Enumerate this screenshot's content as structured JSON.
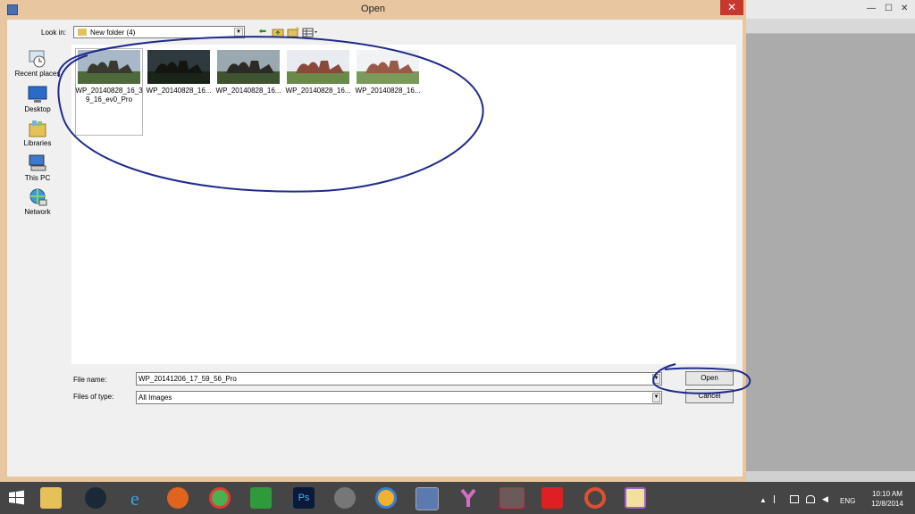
{
  "dialog": {
    "title": "Open",
    "close_glyph": "✕",
    "look_in_label": "Look in:",
    "look_in_value": "New folder (4)",
    "places": [
      {
        "label": "Recent places",
        "icon": "recent-places-icon"
      },
      {
        "label": "Desktop",
        "icon": "desktop-icon"
      },
      {
        "label": "Libraries",
        "icon": "libraries-icon"
      },
      {
        "label": "This PC",
        "icon": "this-pc-icon"
      },
      {
        "label": "Network",
        "icon": "network-icon"
      }
    ],
    "files": [
      {
        "name": "WP_20140828_16_39_16_ev0_Pro"
      },
      {
        "name": "WP_20140828_16..."
      },
      {
        "name": "WP_20140828_16..."
      },
      {
        "name": "WP_20140828_16..."
      },
      {
        "name": "WP_20140828_16..."
      }
    ],
    "file_name_label": "File name:",
    "file_name_value": "WP_20141206_17_59_56_Pro",
    "files_of_type_label": "Files of type:",
    "files_of_type_value": "All Images",
    "open_label": "Open",
    "cancel_label": "Cancel"
  },
  "right_window": {
    "minimize": "—",
    "maximize": "☐",
    "close": "✕"
  },
  "taskbar": {
    "apps": [
      "start",
      "file-explorer",
      "steam",
      "internet-explorer",
      "firefox",
      "chrome",
      "store",
      "photoshop",
      "app-gray",
      "app-sun",
      "app-photo",
      "app-y",
      "app-red-active",
      "app-windows",
      "app-circle",
      "app-note"
    ],
    "language": "ENG",
    "time": "10:10 AM",
    "date": "12/8/2014"
  },
  "colors": {
    "dialog_frame": "#e8c6a0",
    "annotation": "#1f2a8a",
    "close_red": "#c7382f",
    "taskbar": "#454545"
  }
}
